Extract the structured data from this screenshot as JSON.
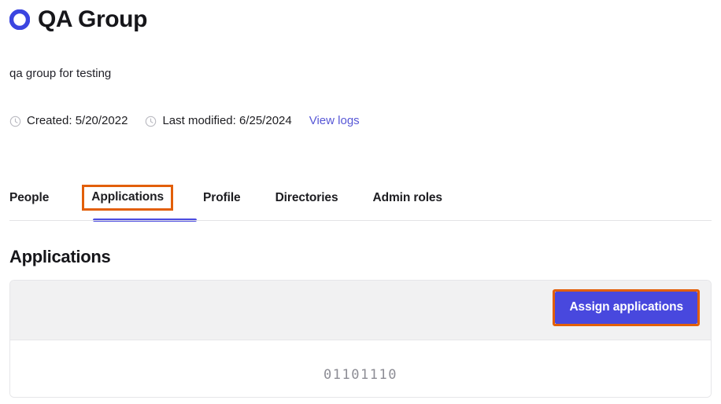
{
  "header": {
    "icon": "group-ring-icon",
    "title": "QA Group",
    "accent_blue": "#4848de"
  },
  "description": "qa group for testing",
  "meta": {
    "clock_icon": "clock-icon",
    "created": "Created: 5/20/2022",
    "last_modified": "Last modified: 6/25/2024",
    "view_logs_label": "View logs",
    "link_color": "#5757d6"
  },
  "tabs": {
    "items": [
      {
        "label": "People",
        "active": false,
        "highlighted": false
      },
      {
        "label": "Applications",
        "active": true,
        "highlighted": true
      },
      {
        "label": "Profile",
        "active": false,
        "highlighted": false
      },
      {
        "label": "Directories",
        "active": false,
        "highlighted": false
      },
      {
        "label": "Admin roles",
        "active": false,
        "highlighted": false
      }
    ],
    "active_underline_color": "#4a4ae0",
    "highlight_color": "#e25f09"
  },
  "section": {
    "heading": "Applications"
  },
  "card": {
    "toolbar": {
      "assign_button_label": "Assign applications",
      "assign_button_color": "#4848de",
      "assign_button_highlight_color": "#e25f09",
      "background": "#f1f1f2"
    },
    "body": {
      "placeholder_text": "01101110"
    }
  }
}
